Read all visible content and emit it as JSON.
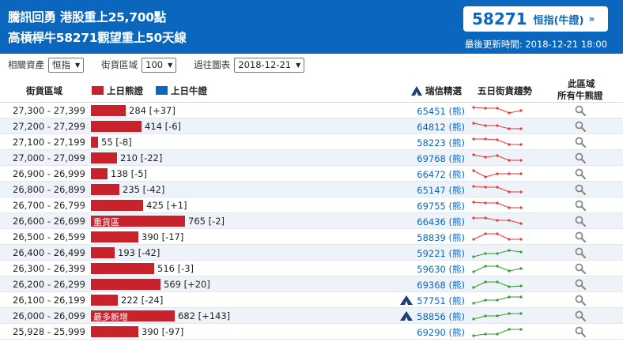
{
  "headline": {
    "line1": "騰訊回勇 港股重上25,700點",
    "line2": "高槓桿牛58271觀望重上50天線"
  },
  "warrant_box": {
    "code": "58271",
    "type": "恒指(牛證)",
    "arrow": "»"
  },
  "update_time": "最後更新時間: 2018-12-21 18:00",
  "filters": [
    {
      "label": "相關資產",
      "value": "恒指"
    },
    {
      "label": "街貨區域",
      "value": "100"
    },
    {
      "label": "過往圖表",
      "value": "2018-12-21"
    }
  ],
  "columns": {
    "range": "街貨區域",
    "bear_legend": "上日熊證",
    "bull_legend": "上日牛證",
    "ubs": "瑞信精選",
    "trend": "五日街貨趨勢",
    "all_line1": "此區域",
    "all_line2": "所有牛熊證"
  },
  "colors": {
    "bear": "#c8232c",
    "bull": "#0b67bd",
    "trend_down": "#e53935",
    "trend_up": "#2e9e2e",
    "banner": "#0b67bd"
  },
  "rows": [
    {
      "range": "27,300 - 27,399",
      "value": 284,
      "value_text": "284 [+37]",
      "bar_label": "",
      "ubs": false,
      "code": "65451 (熊)",
      "trend": "down"
    },
    {
      "range": "27,200 - 27,299",
      "value": 414,
      "value_text": "414 [-6]",
      "bar_label": "",
      "ubs": false,
      "code": "64812 (熊)",
      "trend": "down"
    },
    {
      "range": "27,100 - 27,199",
      "value": 55,
      "value_text": "55 [-8]",
      "bar_label": "",
      "ubs": false,
      "code": "58223 (熊)",
      "trend": "down"
    },
    {
      "range": "27,000 - 27,099",
      "value": 210,
      "value_text": "210 [-22]",
      "bar_label": "",
      "ubs": false,
      "code": "69768 (熊)",
      "trend": "down"
    },
    {
      "range": "26,900 - 26,999",
      "value": 138,
      "value_text": "138 [-5]",
      "bar_label": "",
      "ubs": false,
      "code": "66472 (熊)",
      "trend": "down"
    },
    {
      "range": "26,800 - 26,899",
      "value": 235,
      "value_text": "235 [-42]",
      "bar_label": "",
      "ubs": false,
      "code": "65147 (熊)",
      "trend": "down"
    },
    {
      "range": "26,700 - 26,799",
      "value": 425,
      "value_text": "425 [+1]",
      "bar_label": "",
      "ubs": false,
      "code": "69755 (熊)",
      "trend": "down"
    },
    {
      "range": "26,600 - 26,699",
      "value": 765,
      "value_text": "765 [-2]",
      "bar_label": "重貨區",
      "ubs": false,
      "code": "66436 (熊)",
      "trend": "down"
    },
    {
      "range": "26,500 - 26,599",
      "value": 390,
      "value_text": "390 [-17]",
      "bar_label": "",
      "ubs": false,
      "code": "58839 (熊)",
      "trend": "down"
    },
    {
      "range": "26,400 - 26,499",
      "value": 193,
      "value_text": "193 [-42]",
      "bar_label": "",
      "ubs": false,
      "code": "59221 (熊)",
      "trend": "up"
    },
    {
      "range": "26,300 - 26,399",
      "value": 516,
      "value_text": "516 [-3]",
      "bar_label": "",
      "ubs": false,
      "code": "59630 (熊)",
      "trend": "up"
    },
    {
      "range": "26,200 - 26,299",
      "value": 569,
      "value_text": "569 [+20]",
      "bar_label": "",
      "ubs": false,
      "code": "69368 (熊)",
      "trend": "up"
    },
    {
      "range": "26,100 - 26,199",
      "value": 222,
      "value_text": "222 [-24]",
      "bar_label": "",
      "ubs": true,
      "code": "57751 (熊)",
      "trend": "up"
    },
    {
      "range": "26,000 - 26,099",
      "value": 682,
      "value_text": "682 [+143]",
      "bar_label": "最多新增",
      "ubs": true,
      "code": "58856 (熊)",
      "trend": "up"
    },
    {
      "range": "25,928 - 25,999",
      "value": 390,
      "value_text": "390 [-97]",
      "bar_label": "",
      "ubs": false,
      "code": "69290 (熊)",
      "trend": "up"
    }
  ]
}
